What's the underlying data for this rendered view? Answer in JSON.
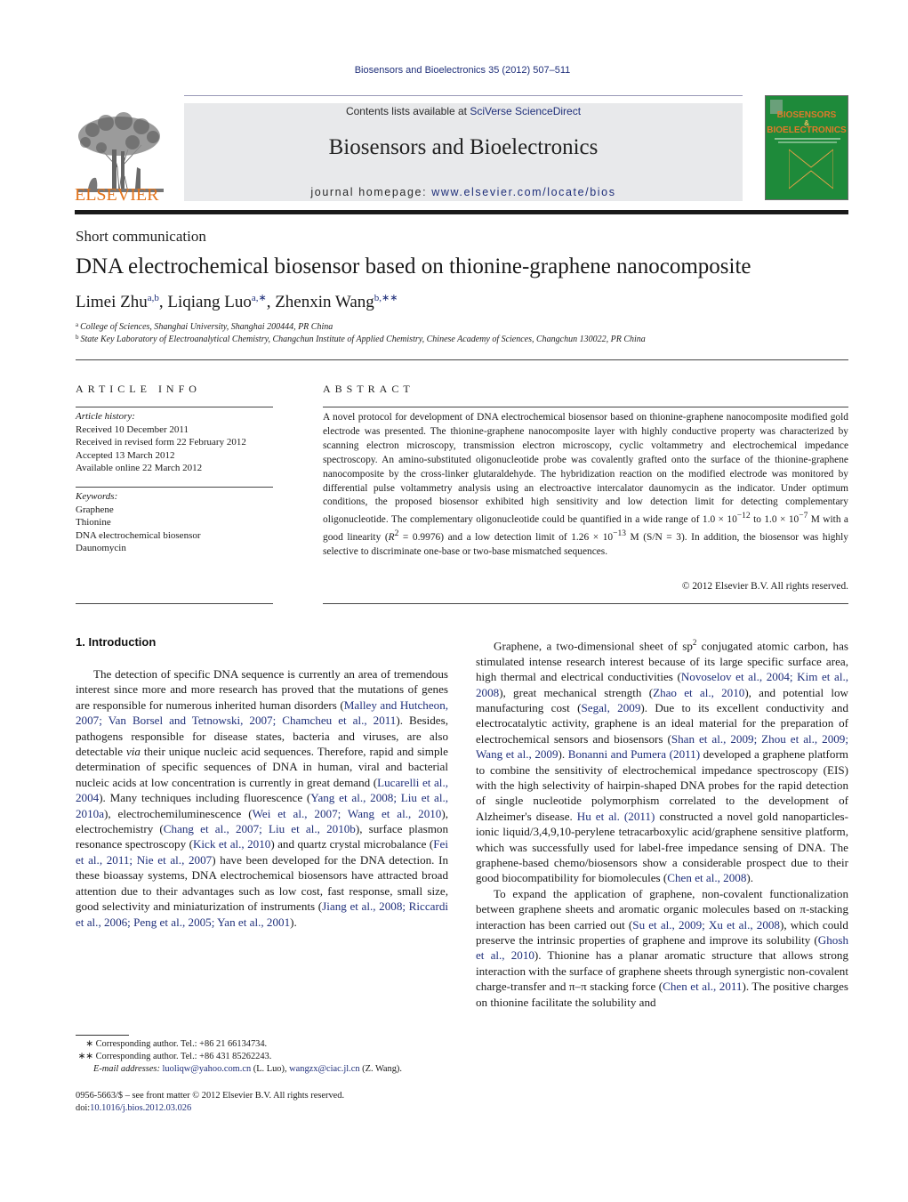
{
  "header": {
    "journal_ref": "Biosensors and Bioelectronics 35 (2012) 507–511",
    "contents_prefix": "Contents lists available at ",
    "contents_link": "SciVerse ScienceDirect",
    "journal_name": "Biosensors and Bioelectronics",
    "homepage_prefix": "journal homepage: ",
    "homepage_link": "www.elsevier.com/locate/bios",
    "publisher_logo": "ELSEVIER",
    "cover_title_1": "BIOSENSORS",
    "cover_amp": "&",
    "cover_title_2": "BIOELECTRONICS",
    "colors": {
      "link": "#1f2f7a",
      "elsevier_orange": "#e2731b",
      "cover_green": "#1e8a3a",
      "header_box": "#e8e9eb"
    }
  },
  "article": {
    "type": "Short communication",
    "title": "DNA electrochemical biosensor based on thionine-graphene nanocomposite",
    "authors": [
      {
        "name": "Limei Zhu",
        "sup": "a,b",
        "sep": ", "
      },
      {
        "name": "Liqiang Luo",
        "sup": "a,∗",
        "sep": ", "
      },
      {
        "name": "Zhenxin Wang",
        "sup": "b,∗∗",
        "sep": ""
      }
    ],
    "affiliations": [
      {
        "mark": "a",
        "text": "College of Sciences, Shanghai University, Shanghai 200444, PR China"
      },
      {
        "mark": "b",
        "text": "State Key Laboratory of Electroanalytical Chemistry, Changchun Institute of Applied Chemistry, Chinese Academy of Sciences, Changchun 130022, PR China"
      }
    ]
  },
  "article_info": {
    "heading": "ARTICLE INFO",
    "history_label": "Article history:",
    "history": [
      "Received 10 December 2011",
      "Received in revised form 22 February 2012",
      "Accepted 13 March 2012",
      "Available online 22 March 2012"
    ],
    "keywords_label": "Keywords:",
    "keywords": [
      "Graphene",
      "Thionine",
      "DNA electrochemical biosensor",
      "Daunomycin"
    ]
  },
  "abstract": {
    "heading": "ABSTRACT",
    "text_1": "A novel protocol for development of DNA electrochemical biosensor based on thionine-graphene nanocomposite modified gold electrode was presented. The thionine-graphene nanocomposite layer with highly conductive property was characterized by scanning electron microscopy, transmission electron microscopy, cyclic voltammetry and electrochemical impedance spectroscopy. An amino-substituted oligonucleotide probe was covalently grafted onto the surface of the thionine-graphene nanocomposite by the cross-linker glutaraldehyde. The hybridization reaction on the modified electrode was monitored by differential pulse voltammetry analysis using an electroactive intercalator daunomycin as the indicator. Under optimum conditions, the proposed biosensor exhibited high sensitivity and low detection limit for detecting complementary oligonucleotide. The complementary oligonucleotide could be quantified in a wide range of 1.0 × 10",
    "exp_1": "−12",
    "text_2": " to 1.0 × 10",
    "exp_2": "−7",
    "text_3": " M with a good linearity (",
    "r_symbol": "R",
    "r_exp": "2",
    "text_4": " = 0.9976) and a low detection limit of 1.26 × 10",
    "exp_3": "−13",
    "text_5": " M (S/N = 3). In addition, the biosensor was highly selective to discriminate one-base or two-base mismatched sequences.",
    "copyright": "© 2012 Elsevier B.V. All rights reserved."
  },
  "body": {
    "section_heading": "1.  Introduction",
    "left": {
      "p1": [
        {
          "t": "The detection of specific DNA sequence is currently an area of tremendous interest since more and more research has proved that the mutations of genes are responsible for numerous inherited human disorders ("
        },
        {
          "l": "Malley and Hutcheon, 2007; Van Borsel and Tetnowski, 2007; Chamcheu et al., 2011"
        },
        {
          "t": "). Besides, pathogens responsible for disease states, bacteria and viruses, are also detectable "
        },
        {
          "i": "via"
        },
        {
          "t": " their unique nucleic acid sequences. Therefore, rapid and simple determination of specific sequences of DNA in human, viral and bacterial nucleic acids at low concentration is currently in great demand ("
        },
        {
          "l": "Lucarelli et al., 2004"
        },
        {
          "t": "). Many techniques including fluorescence ("
        },
        {
          "l": "Yang et al., 2008; Liu et al., 2010a"
        },
        {
          "t": "), electrochemiluminescence ("
        },
        {
          "l": "Wei et al., 2007; Wang et al., 2010"
        },
        {
          "t": "), electrochemistry ("
        },
        {
          "l": "Chang et al., 2007; Liu et al., 2010b"
        },
        {
          "t": "), surface plasmon resonance spectroscopy ("
        },
        {
          "l": "Kick et al., 2010"
        },
        {
          "t": ") and quartz crystal microbalance ("
        },
        {
          "l": "Fei et al., 2011; Nie et al., 2007"
        },
        {
          "t": ") have been developed for the DNA detection. In these bioassay systems, DNA electrochemical biosensors have attracted broad attention due to their advantages such as low cost, fast response, small size, good selectivity and miniaturization of instruments ("
        },
        {
          "l": "Jiang et al., 2008; Riccardi et al., 2006; Peng et al., 2005; Yan et al., 2001"
        },
        {
          "t": ")."
        }
      ]
    },
    "right": {
      "p1": [
        {
          "t": "Graphene, a two-dimensional sheet of sp"
        },
        {
          "s": "2"
        },
        {
          "t": " conjugated atomic carbon, has stimulated intense research interest because of its large specific surface area, high thermal and electrical conductivities ("
        },
        {
          "l": "Novoselov et al., 2004; Kim et al., 2008"
        },
        {
          "t": "), great mechanical strength ("
        },
        {
          "l": "Zhao et al., 2010"
        },
        {
          "t": "), and potential low manufacturing cost ("
        },
        {
          "l": "Segal, 2009"
        },
        {
          "t": "). Due to its excellent conductivity and electrocatalytic activity, graphene is an ideal material for the preparation of electrochemical sensors and biosensors ("
        },
        {
          "l": "Shan et al., 2009; Zhou et al., 2009; Wang et al., 2009"
        },
        {
          "t": "). "
        },
        {
          "l": "Bonanni and Pumera (2011)"
        },
        {
          "t": " developed a graphene platform to combine the sensitivity of electrochemical impedance spectroscopy (EIS) with the high selectivity of hairpin-shaped DNA probes for the rapid detection of single nucleotide polymorphism correlated to the development of Alzheimer's disease. "
        },
        {
          "l": "Hu et al. (2011)"
        },
        {
          "t": " constructed a novel gold nanoparticles-ionic liquid/3,4,9,10-perylene tetracarboxylic acid/graphene sensitive platform, which was successfully used for label-free impedance sensing of DNA. The graphene-based chemo/biosensors show a considerable prospect due to their good biocompatibility for biomolecules ("
        },
        {
          "l": "Chen et al., 2008"
        },
        {
          "t": ")."
        }
      ],
      "p2": [
        {
          "t": "To expand the application of graphene, non-covalent functionalization between graphene sheets and aromatic organic molecules based on π-stacking interaction has been carried out ("
        },
        {
          "l": "Su et al., 2009; Xu et al., 2008"
        },
        {
          "t": "), which could preserve the intrinsic properties of graphene and improve its solubility ("
        },
        {
          "l": "Ghosh et al., 2010"
        },
        {
          "t": "). Thionine has a planar aromatic structure that allows strong interaction with the surface of graphene sheets through synergistic non-covalent charge-transfer and π–π stacking force ("
        },
        {
          "l": "Chen et al., 2011"
        },
        {
          "t": "). The positive charges on thionine facilitate the solubility and"
        }
      ]
    }
  },
  "footnotes": {
    "fn1_mark": "∗",
    "fn1_text": "Corresponding author. Tel.: +86 21 66134734.",
    "fn2_mark": "∗∗",
    "fn2_text": "Corresponding author. Tel.: +86 431 85262243.",
    "email_label": "E-mail addresses:",
    "email_1": "luoliqw@yahoo.com.cn",
    "email_1_owner": " (L. Luo), ",
    "email_2": "wangzx@ciac.jl.cn",
    "email_2_owner": " (Z. Wang).",
    "front_matter": "0956-5663/$ – see front matter © 2012 Elsevier B.V. All rights reserved.",
    "doi_prefix": "doi:",
    "doi_link": "10.1016/j.bios.2012.03.026"
  }
}
